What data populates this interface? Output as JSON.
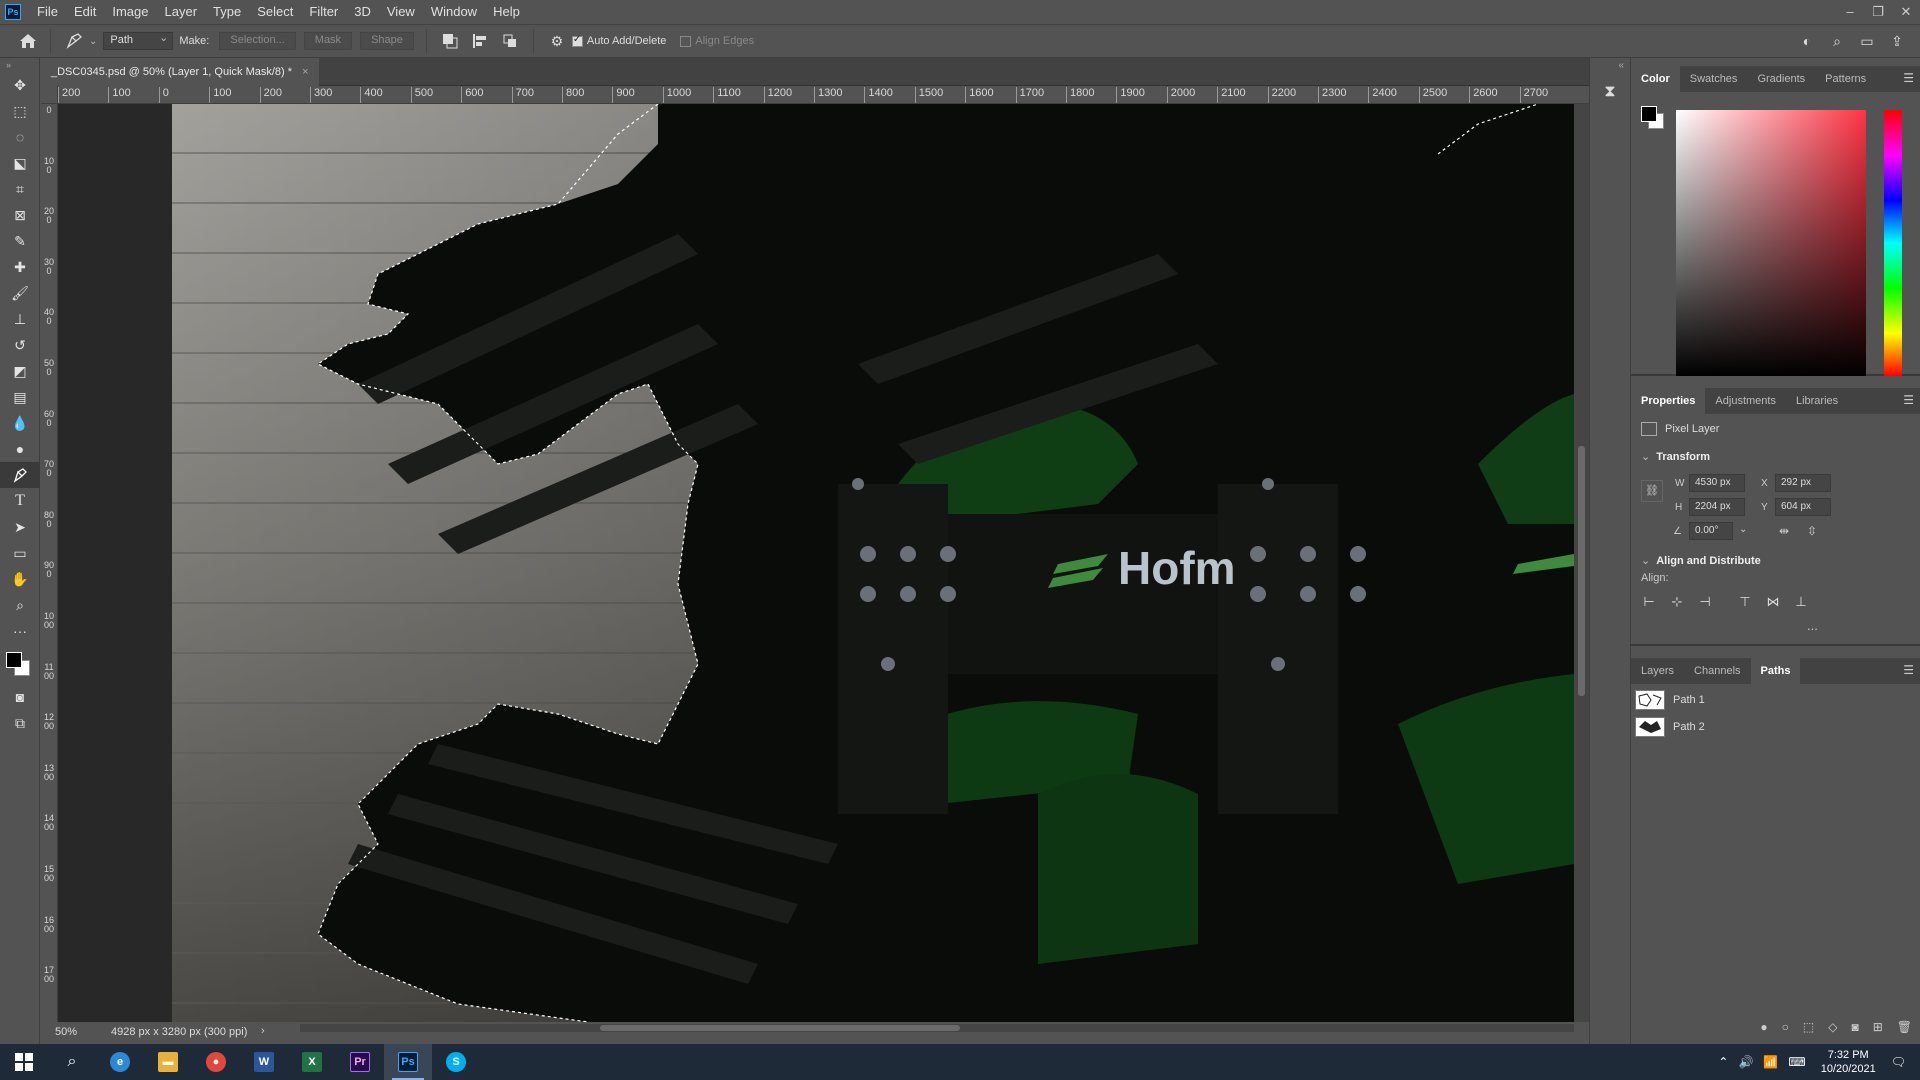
{
  "menubar": {
    "logo": "Ps",
    "items": [
      "File",
      "Edit",
      "Image",
      "Layer",
      "Type",
      "Select",
      "Filter",
      "3D",
      "View",
      "Window",
      "Help"
    ]
  },
  "options": {
    "mode": "Path",
    "make_label": "Make:",
    "selection_btn": "Selection...",
    "mask_btn": "Mask",
    "shape_btn": "Shape",
    "auto_add_delete": "Auto Add/Delete",
    "align_edges": "Align Edges"
  },
  "document": {
    "tab_title": "_DSC0345.psd @ 50% (Layer 1, Quick Mask/8) *",
    "ruler_h": [
      "200",
      "100",
      "0",
      "100",
      "200",
      "300",
      "400",
      "500",
      "600",
      "700",
      "800",
      "900",
      "1000",
      "1100",
      "1200",
      "1300",
      "1400",
      "1500",
      "1600",
      "1700",
      "1800",
      "1900",
      "2000",
      "2100",
      "2200",
      "2300",
      "2400",
      "2500",
      "2600",
      "2700"
    ],
    "ruler_v": [
      "0",
      "100",
      "200",
      "300",
      "400",
      "500",
      "600",
      "700",
      "800",
      "900",
      "1000",
      "1100",
      "1200",
      "1300",
      "1400",
      "1500",
      "1600",
      "1700"
    ],
    "canvas_text": "Hofm"
  },
  "status": {
    "zoom": "50%",
    "info": "4928 px x 3280 px (300 ppi)"
  },
  "color_panel": {
    "tabs": [
      "Color",
      "Swatches",
      "Gradients",
      "Patterns"
    ],
    "active_tab": "Color"
  },
  "properties_panel": {
    "tabs": [
      "Properties",
      "Adjustments",
      "Libraries"
    ],
    "layer_type": "Pixel Layer",
    "transform_title": "Transform",
    "w_label": "W",
    "w_value": "4530 px",
    "h_label": "H",
    "h_value": "2204 px",
    "x_label": "X",
    "x_value": "292 px",
    "y_label": "Y",
    "y_value": "604 px",
    "angle": "0.00°",
    "align_title": "Align and Distribute",
    "align_label": "Align:",
    "more": "..."
  },
  "paths_panel": {
    "tabs": [
      "Layers",
      "Channels",
      "Paths"
    ],
    "active_tab": "Paths",
    "paths": [
      "Path 1",
      "Path 2"
    ]
  },
  "taskbar": {
    "time": "7:32 PM",
    "date": "10/20/2021",
    "apps": [
      {
        "name": "edge",
        "label": "e",
        "color": "#2b8ad6"
      },
      {
        "name": "file-explorer",
        "label": "▬",
        "color": "#e8b23a"
      },
      {
        "name": "chrome",
        "label": "●",
        "color": "#e0483b"
      },
      {
        "name": "word",
        "label": "W",
        "color": "#2b579a"
      },
      {
        "name": "excel",
        "label": "X",
        "color": "#217346"
      },
      {
        "name": "premiere",
        "label": "Pr",
        "color": "#2a0a4a"
      },
      {
        "name": "photoshop",
        "label": "Ps",
        "color": "#0b1c30"
      },
      {
        "name": "skype",
        "label": "S",
        "color": "#00aff0"
      }
    ]
  },
  "colors": {
    "accent": "#31a8ff",
    "ui_bg": "#535353",
    "dark_bg": "#424242",
    "taskbar": "#1f2a38"
  }
}
